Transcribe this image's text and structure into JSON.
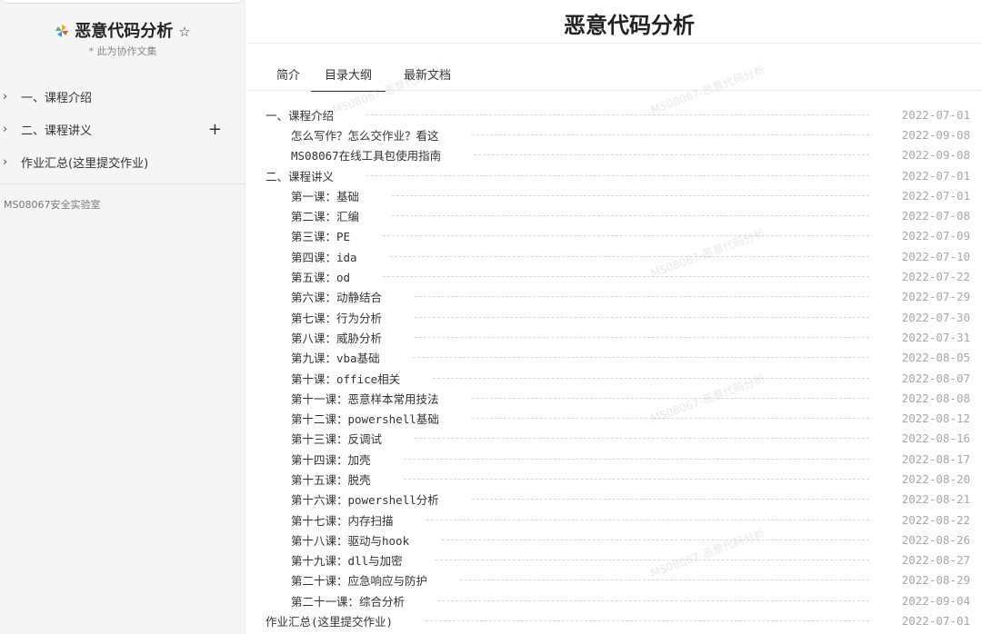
{
  "sidebar": {
    "title": "恶意代码分析",
    "subtitle": "* 此为协作文集",
    "items": [
      {
        "label": "一、课程介绍"
      },
      {
        "label": "二、课程讲义"
      },
      {
        "label": "作业汇总(这里提交作业)"
      }
    ],
    "footer": "MS08067安全实验室"
  },
  "main": {
    "title": "恶意代码分析",
    "tabs": [
      {
        "label": "简介"
      },
      {
        "label": "目录大纲"
      },
      {
        "label": "最新文档"
      }
    ],
    "active_tab": "目录大纲"
  },
  "toc": [
    {
      "label": "一、课程介绍",
      "date": "2022-07-01",
      "level": 0
    },
    {
      "label": "怎么写作？怎么交作业？看这",
      "date": "2022-09-08",
      "level": 1
    },
    {
      "label": "MS08067在线工具包使用指南",
      "date": "2022-09-08",
      "level": 1
    },
    {
      "label": "二、课程讲义",
      "date": "2022-07-01",
      "level": 0
    },
    {
      "label": "第一课：基础",
      "date": "2022-07-01",
      "level": 1
    },
    {
      "label": "第二课：汇编",
      "date": "2022-07-08",
      "level": 1
    },
    {
      "label": "第三课：PE",
      "date": "2022-07-09",
      "level": 1
    },
    {
      "label": "第四课：ida",
      "date": "2022-07-10",
      "level": 1
    },
    {
      "label": "第五课：od",
      "date": "2022-07-22",
      "level": 1
    },
    {
      "label": "第六课：动静结合",
      "date": "2022-07-29",
      "level": 1
    },
    {
      "label": "第七课：行为分析",
      "date": "2022-07-30",
      "level": 1
    },
    {
      "label": "第八课：威胁分析",
      "date": "2022-07-31",
      "level": 1
    },
    {
      "label": "第九课：vba基础",
      "date": "2022-08-05",
      "level": 1
    },
    {
      "label": "第十课：office相关",
      "date": "2022-08-07",
      "level": 1
    },
    {
      "label": "第十一课：恶意样本常用技法",
      "date": "2022-08-08",
      "level": 1
    },
    {
      "label": "第十二课：powershell基础",
      "date": "2022-08-12",
      "level": 1
    },
    {
      "label": "第十三课：反调试",
      "date": "2022-08-16",
      "level": 1
    },
    {
      "label": "第十四课：加壳",
      "date": "2022-08-17",
      "level": 1
    },
    {
      "label": "第十五课：脱壳",
      "date": "2022-08-20",
      "level": 1
    },
    {
      "label": "第十六课：powershell分析",
      "date": "2022-08-21",
      "level": 1
    },
    {
      "label": "第十七课：内存扫描",
      "date": "2022-08-22",
      "level": 1
    },
    {
      "label": "第十八课：驱动与hook",
      "date": "2022-08-26",
      "level": 1
    },
    {
      "label": "第十九课：dll与加密",
      "date": "2022-08-27",
      "level": 1
    },
    {
      "label": "第二十课：应急响应与防护",
      "date": "2022-08-29",
      "level": 1
    },
    {
      "label": "第二十一课：综合分析",
      "date": "2022-09-04",
      "level": 1
    },
    {
      "label": "作业汇总(这里提交作业)",
      "date": "2022-07-01",
      "level": 0
    }
  ],
  "watermark": "MS08067-恶意代码分析",
  "icons": {
    "title_icon": "pinwheel-icon",
    "favorite": "star-outline-icon",
    "expand": "chevron-right-icon",
    "add": "plus-icon"
  },
  "colors": {
    "sidebar_bg": "#f5f5f6",
    "date": "#a8a8a8",
    "active_tab_underline": "#333333"
  }
}
